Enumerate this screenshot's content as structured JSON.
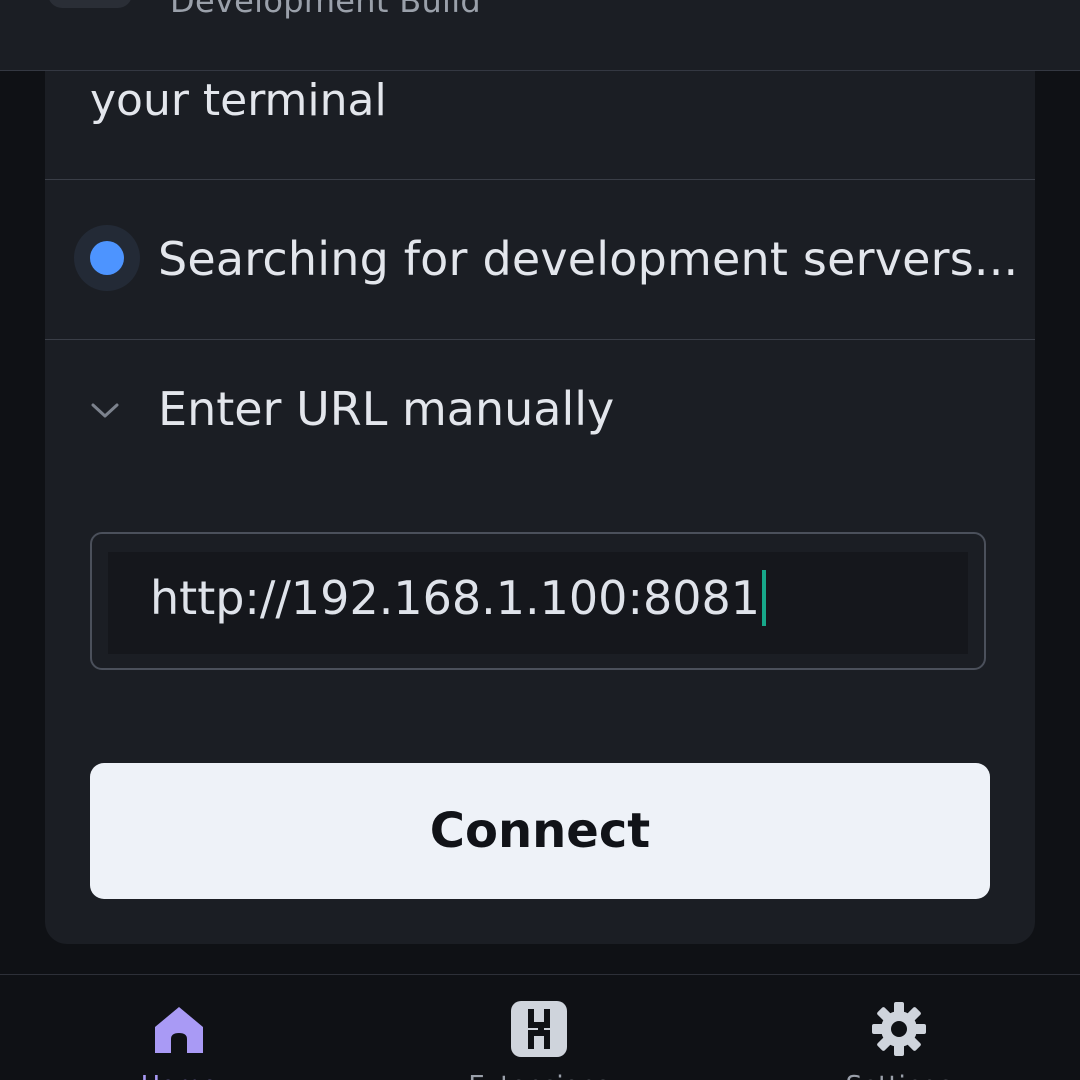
{
  "header": {
    "subtitle": "Development Build"
  },
  "card": {
    "step_text": "your terminal",
    "search_status": "Searching for development servers...",
    "manual_toggle_label": "Enter URL manually",
    "url_input_value": "http://192.168.1.100:8081",
    "connect_label": "Connect"
  },
  "nav": {
    "items": [
      {
        "label": "Home",
        "icon": "home-icon",
        "active": true
      },
      {
        "label": "Extensions",
        "icon": "extensions-icon",
        "active": false
      },
      {
        "label": "Settings",
        "icon": "gear-icon",
        "active": false
      }
    ]
  },
  "colors": {
    "accent": "#a99af5",
    "status_dot": "#4d94ff",
    "caret": "#17a88a",
    "button_bg": "#eef2f8"
  }
}
